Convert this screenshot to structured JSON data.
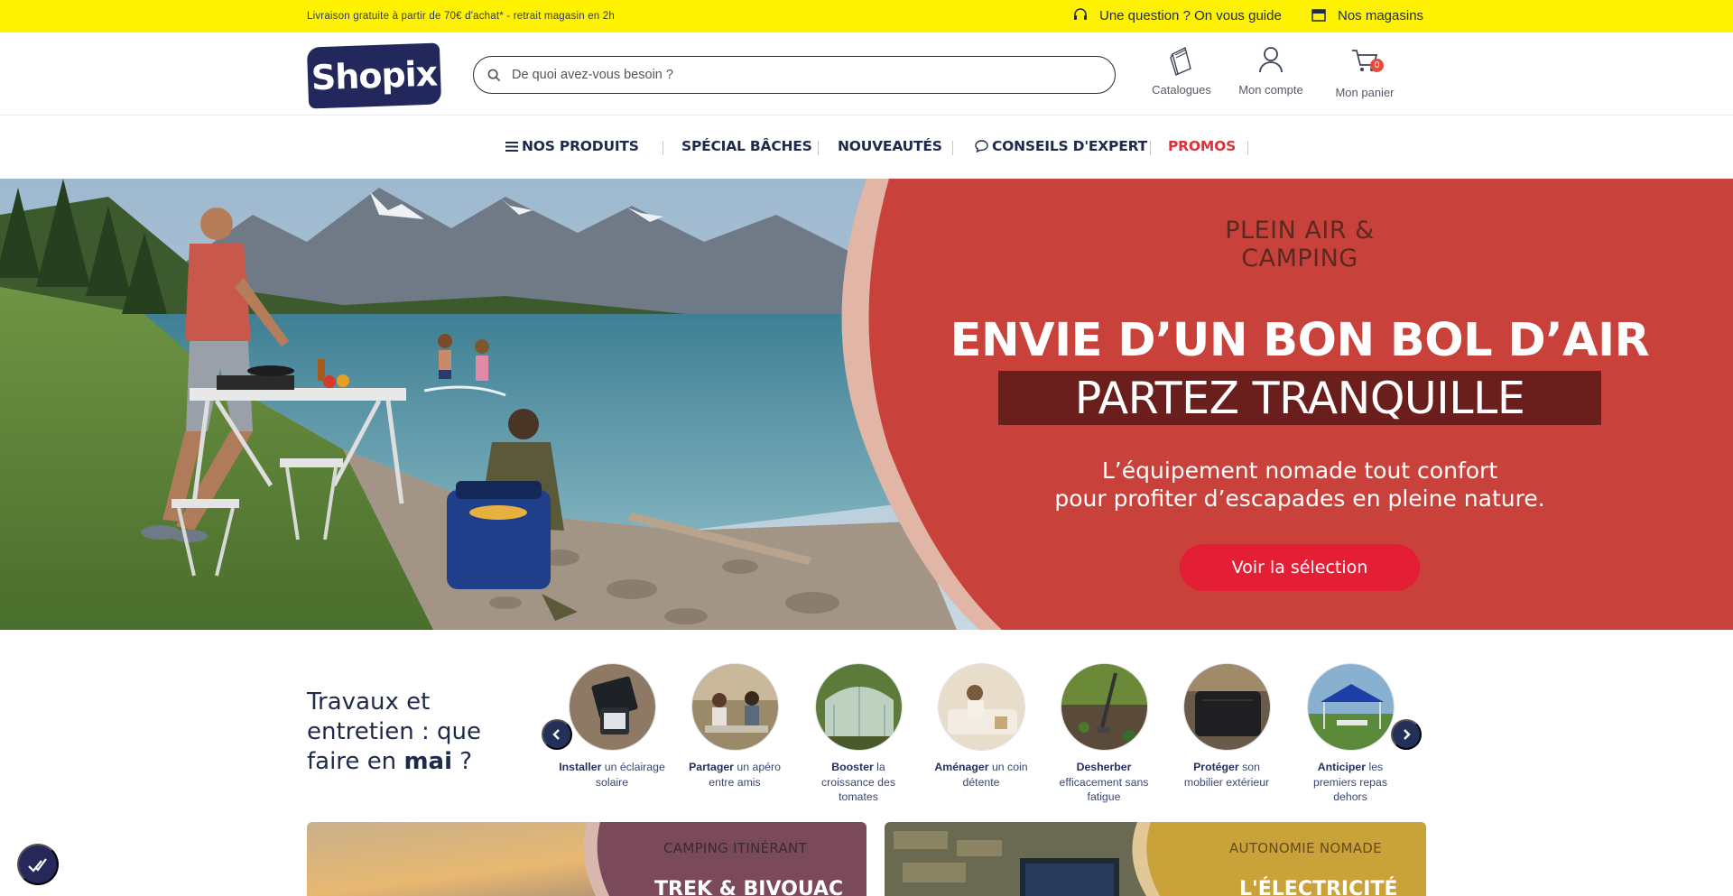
{
  "topbar": {
    "promo_text": "Livraison gratuite à partir de 70€ d'achat* - retrait magasin en 2h",
    "help_label": "Une question ? On vous guide",
    "stores_label": "Nos magasins"
  },
  "header": {
    "logo_text": "Shopix",
    "search_placeholder": "De quoi avez-vous besoin ?",
    "catalogues_label": "Catalogues",
    "account_label": "Mon compte",
    "cart_label": "Mon panier",
    "cart_count": "0"
  },
  "nav": {
    "products": "NOS PRODUITS",
    "special": "SPÉCIAL BÂCHES",
    "new": "NOUVEAUTÉS",
    "expert": "CONSEILS D'EXPERT",
    "promos": "PROMOS"
  },
  "hero": {
    "kicker": "PLEIN AIR & CAMPING",
    "title": "ENVIE D’UN BON BOL D’AIR ?",
    "band": "PARTEZ TRANQUILLE",
    "sub_line1": "L’équipement nomade tout confort",
    "sub_line2": "pour profiter d’escapades en pleine nature.",
    "cta": "Voir la sélection"
  },
  "season": {
    "title_part1": "Travaux et entretien : que faire en",
    "title_bold": "mai",
    "title_end": "?",
    "items": [
      {
        "bold": "Installer",
        "rest": "un éclairage solaire"
      },
      {
        "bold": "Partager",
        "rest": "un apéro entre amis"
      },
      {
        "bold": "Booster",
        "rest": "la croissance des tomates"
      },
      {
        "bold": "Aménager",
        "rest": "un coin détente"
      },
      {
        "bold": "Desherber",
        "rest": "efficacement sans fatigue"
      },
      {
        "bold": "Protéger",
        "rest": "son mobilier extérieur"
      },
      {
        "bold": "Anticiper",
        "rest": "les premiers repas dehors"
      }
    ]
  },
  "cards": [
    {
      "kicker": "CAMPING ITINÉRANT",
      "title": "TREK & BIVOUAC"
    },
    {
      "kicker": "AUTONOMIE NOMADE",
      "title": "L'ÉLECTRICITÉ"
    }
  ],
  "colors": {
    "topbar_bg": "#fff200",
    "brand_navy": "#23285c",
    "promo_red": "#e0303a",
    "hero_panel": "#c8413a",
    "cta_red": "#e41e34"
  }
}
